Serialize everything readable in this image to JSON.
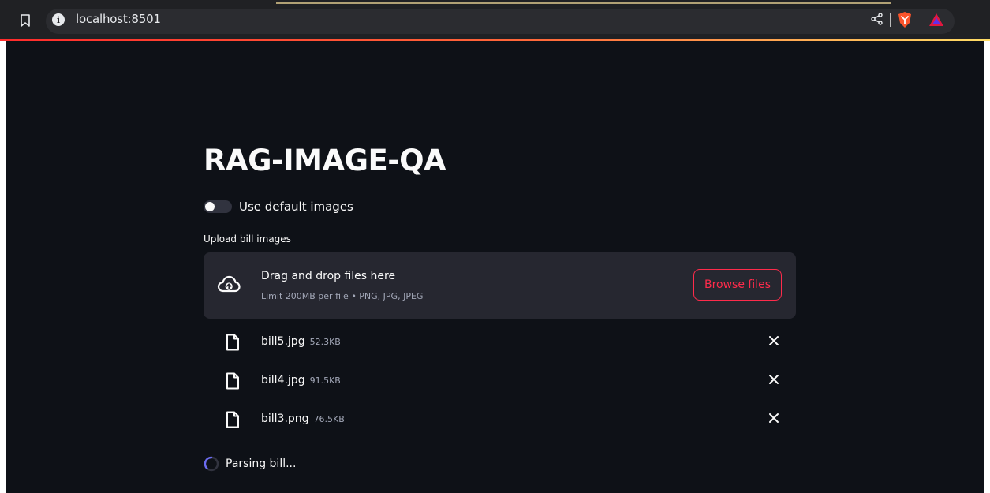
{
  "browser": {
    "url": "localhost:8501",
    "info_glyph": "i",
    "icons": [
      "bookmark-icon",
      "site-info-icon",
      "share-icon",
      "brave-shields-icon",
      "brave-rewards-icon"
    ]
  },
  "app": {
    "title": "RAG-IMAGE-QA",
    "toggle": {
      "label": "Use default images",
      "checked": false
    },
    "uploader": {
      "label": "Upload bill images",
      "drop_text": "Drag and drop files here",
      "limit_text": "Limit 200MB per file • PNG, JPG, JPEG",
      "browse_label": "Browse files"
    },
    "files": [
      {
        "name": "bill5.jpg",
        "size": "52.3KB"
      },
      {
        "name": "bill4.jpg",
        "size": "91.5KB"
      },
      {
        "name": "bill3.png",
        "size": "76.5KB"
      }
    ],
    "status": "Parsing bill..."
  },
  "colors": {
    "app_background": "#0e1117",
    "dropzone": "#262730",
    "accent": "#ff2b4b",
    "spinner": "#6b6bf0"
  }
}
